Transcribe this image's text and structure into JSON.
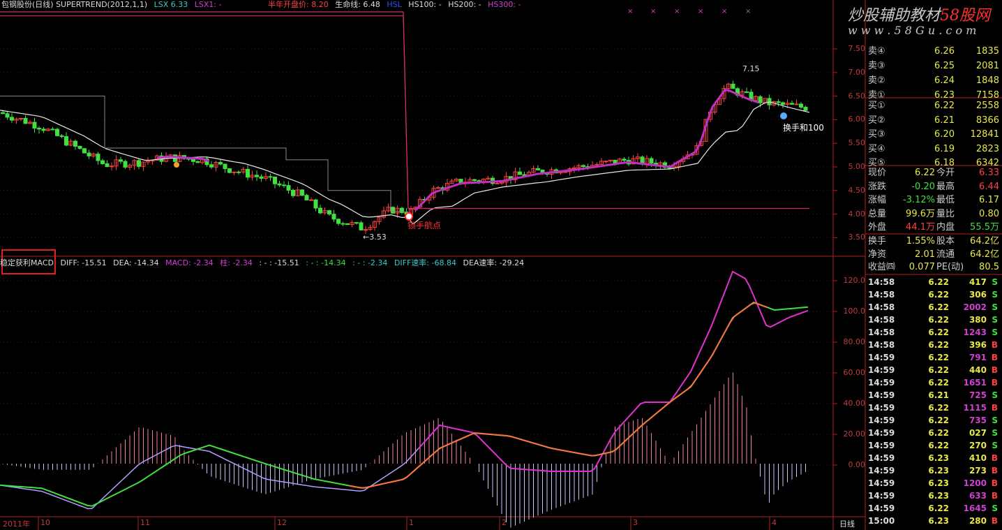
{
  "header": {
    "title": "包钢股份(日线) SUPERTREND(2012,1,1)",
    "lsx": "LSX 6.33",
    "lsx1": "LSX1: -",
    "avg_cost": "半年开盘价: 8.20",
    "life_line": "生命线: 6.48",
    "hsl": "HSL",
    "hs100": "HS100: -",
    "hs200": "HS200: -",
    "hs300": "HS300: -"
  },
  "watermark": {
    "line1": "炒股辅助教材",
    "brand": "58股网",
    "line2": "w w w . 5 8 G u . c o m"
  },
  "main_chart": {
    "annotations": {
      "low": "←3.53",
      "high": "7.15",
      "buy": "锁手航点",
      "turnover": "换手和100"
    },
    "yticks": [
      "7.50",
      "7.00",
      "6.50",
      "6.00",
      "5.50",
      "5.00",
      "4.50",
      "4.00",
      "3.50"
    ]
  },
  "indicator": {
    "name": "稳定获利MACD",
    "diff": "DIFF: -15.51",
    "dea": "DEA: -14.34",
    "macd": "MACD: -2.34",
    "zhu": "柱: -2.34",
    "v1": ": - : -15.51",
    "v2": ": - : -14.34",
    "v3": ": - : -2.34",
    "diff_rate": "DIFF速率: -68.84",
    "dea_rate": "DEA速率: -29.24",
    "yticks": [
      "120.0",
      "100.0",
      "80.00",
      "60.00",
      "40.00",
      "20.00",
      "0.00"
    ]
  },
  "xaxis": {
    "year": "2011年",
    "labels": [
      "10",
      "11",
      "12",
      "1",
      "2",
      "3",
      "4"
    ],
    "period": "日线"
  },
  "orderbook": {
    "asks": [
      {
        "label": "卖④",
        "price": "6.26",
        "vol": "1835"
      },
      {
        "label": "卖③",
        "price": "6.25",
        "vol": "2081"
      },
      {
        "label": "卖②",
        "price": "6.24",
        "vol": "1848"
      },
      {
        "label": "卖①",
        "price": "6.23",
        "vol": "7158"
      }
    ],
    "bids": [
      {
        "label": "买①",
        "price": "6.22",
        "vol": "2558"
      },
      {
        "label": "买②",
        "price": "6.21",
        "vol": "8366"
      },
      {
        "label": "买③",
        "price": "6.20",
        "vol": "12841"
      },
      {
        "label": "买④",
        "price": "6.19",
        "vol": "2823"
      },
      {
        "label": "买⑤",
        "price": "6.18",
        "vol": "6342"
      }
    ]
  },
  "stats": [
    {
      "l1": "现价",
      "v1": "6.22",
      "l2": "今开",
      "v2": "6.33",
      "c1": "#e8e84a",
      "c2": "#ff4040"
    },
    {
      "l1": "涨跌",
      "v1": "-0.20",
      "l2": "最高",
      "v2": "6.44",
      "c1": "#40e040",
      "c2": "#ff4040"
    },
    {
      "l1": "涨幅",
      "v1": "-3.12%",
      "l2": "最低",
      "v2": "6.17",
      "c1": "#40e040",
      "c2": "#e8e84a"
    },
    {
      "l1": "总量",
      "v1": "99.6万",
      "l2": "量比",
      "v2": "0.80",
      "c1": "#e8e84a",
      "c2": "#e8e84a"
    },
    {
      "l1": "外盘",
      "v1": "44.1万",
      "l2": "内盘",
      "v2": "55.5万",
      "c1": "#ff4040",
      "c2": "#40e040"
    },
    {
      "l1": "换手",
      "v1": "1.55%",
      "l2": "股本",
      "v2": "64.2亿",
      "c1": "#e8e84a",
      "c2": "#e8e84a"
    },
    {
      "l1": "净资",
      "v1": "2.01",
      "l2": "流通",
      "v2": "64.2亿",
      "c1": "#e8e84a",
      "c2": "#e8e84a"
    },
    {
      "l1": "收益㈣",
      "v1": "0.077",
      "l2": "PE(动)",
      "v2": "80.5",
      "c1": "#e8e84a",
      "c2": "#e8e84a"
    }
  ],
  "ticks": [
    {
      "t": "14:58",
      "p": "6.22",
      "v": "417",
      "s": "S"
    },
    {
      "t": "14:58",
      "p": "6.22",
      "v": "306",
      "s": "S"
    },
    {
      "t": "14:58",
      "p": "6.22",
      "v": "2002",
      "s": "S"
    },
    {
      "t": "14:58",
      "p": "6.22",
      "v": "380",
      "s": "S"
    },
    {
      "t": "14:58",
      "p": "6.22",
      "v": "1243",
      "s": "S"
    },
    {
      "t": "14:58",
      "p": "6.22",
      "v": "396",
      "s": "B"
    },
    {
      "t": "14:59",
      "p": "6.22",
      "v": "791",
      "s": "B"
    },
    {
      "t": "14:59",
      "p": "6.22",
      "v": "440",
      "s": "B"
    },
    {
      "t": "14:59",
      "p": "6.22",
      "v": "1651",
      "s": "B"
    },
    {
      "t": "14:59",
      "p": "6.21",
      "v": "725",
      "s": "S"
    },
    {
      "t": "14:59",
      "p": "6.22",
      "v": "1115",
      "s": "B"
    },
    {
      "t": "14:59",
      "p": "6.22",
      "v": "735",
      "s": "S"
    },
    {
      "t": "14:59",
      "p": "6.22",
      "v": "027",
      "s": "S"
    },
    {
      "t": "14:59",
      "p": "6.22",
      "v": "270",
      "s": "S"
    },
    {
      "t": "14:59",
      "p": "6.23",
      "v": "410",
      "s": "B"
    },
    {
      "t": "14:59",
      "p": "6.23",
      "v": "273",
      "s": "B"
    },
    {
      "t": "14:59",
      "p": "6.23",
      "v": "1200",
      "s": "B"
    },
    {
      "t": "14:59",
      "p": "6.23",
      "v": "633",
      "s": "B"
    },
    {
      "t": "14:59",
      "p": "6.22",
      "v": "1645",
      "s": "S"
    },
    {
      "t": "15:00",
      "p": "6.23",
      "v": "280",
      "s": "B"
    }
  ]
}
